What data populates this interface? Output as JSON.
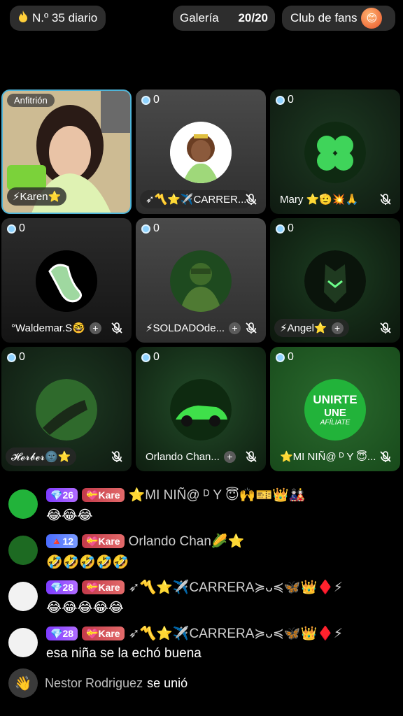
{
  "header": {
    "daily_icon": "fire-icon",
    "daily_label": "N.º 35 diario",
    "gallery_label": "Galería",
    "gallery_count": "20/20",
    "fans_label": "Club de fans",
    "fans_badge_icon": "fan-club-badge-icon"
  },
  "tiles": [
    {
      "host_label": "Anfitrión",
      "name": "⚡Karen⭐"
    },
    {
      "count": "0",
      "name": "➶〽️⭐✈️CARRER..."
    },
    {
      "count": "0",
      "name": "Mary ⭐🫡💥🙏"
    },
    {
      "count": "0",
      "name": "°Waldemar.S🤓"
    },
    {
      "count": "0",
      "name": "⚡SOLDADOde..."
    },
    {
      "count": "0",
      "name": "⚡Angel⭐"
    },
    {
      "count": "0",
      "name": "𝓗𝓮𝓻𝓫𝓮𝓻🌚⭐"
    },
    {
      "count": "0",
      "name": "Orlando Chan..."
    },
    {
      "count": "0",
      "name": "⭐MI NIÑ@ ᴰ Y 😇..."
    }
  ],
  "tile8_logo": {
    "line1": "UNIRTE",
    "line2": "UNE",
    "line3": "AFÍLIATE"
  },
  "chat": [
    {
      "level": "26",
      "fan": "Kare",
      "line1": "⭐MI NIÑ@ ᴰ Y 😇🙌🎫👑🎎",
      "line2": "😂😂😂"
    },
    {
      "level": "12",
      "fan": "Kare",
      "line1": "Orlando Chan🌽⭐",
      "line2": "🤣🤣🤣🤣🤣"
    },
    {
      "level": "28",
      "fan": "Kare",
      "line1": "➶〽️⭐✈️CARRERA≽ᴗ≼🦋👑♦️⚡",
      "line2": "😂😂😂😂😂"
    },
    {
      "level": "28",
      "fan": "Kare",
      "line1": "➶〽️⭐✈️CARRERA≽ᴗ≼🦋👑♦️⚡",
      "line2": "esa niña se la echó buena"
    }
  ],
  "joined": {
    "name": "Nestor Rodriguez",
    "text": "se unió"
  }
}
